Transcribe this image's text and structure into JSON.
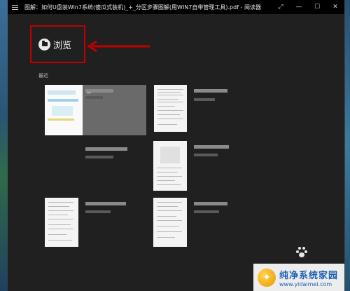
{
  "window": {
    "title": "图解：如何U盘装Win7系统(傻瓜式装机)_+_分区步骤图解(用WIN7自带管理工具).pdf - 阅读器",
    "buttons": {
      "fullscreen": "⤢",
      "minimize": "—",
      "maximize": "☐",
      "close": "✕"
    }
  },
  "browse": {
    "label": "浏览"
  },
  "recent": {
    "label": "最近"
  },
  "watermark": {
    "main": "纯净系统家园",
    "url": "www.yidaimei.com"
  },
  "colors": {
    "accent_box": "#c00000",
    "background": "#202020",
    "titlebar": "#000000"
  }
}
